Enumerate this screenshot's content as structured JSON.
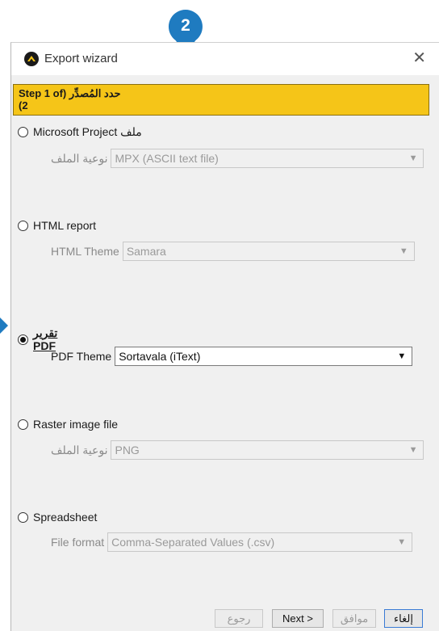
{
  "callout": {
    "number": "2",
    "color": "#1f7bc0"
  },
  "window": {
    "title": "Export wizard",
    "close_glyph": "✕"
  },
  "step": {
    "line1": "Step 1 of) حدد المُصدِّر",
    "line2": "(2"
  },
  "options": [
    {
      "label": "Microsoft Project ملف",
      "checked": false,
      "field_label": "نوعية الملف",
      "field_value": "MPX (ASCII text file)",
      "enabled": false
    },
    {
      "label": "HTML report",
      "checked": false,
      "field_label": "HTML Theme",
      "field_value": "Samara",
      "enabled": false
    },
    {
      "label_line1": "تقرير",
      "label_line2": "PDF",
      "checked": true,
      "field_label": "PDF Theme",
      "field_value": "Sortavala (iText)",
      "enabled": true
    },
    {
      "label": "Raster image file",
      "checked": false,
      "field_label": "نوعية الملف",
      "field_value": "PNG",
      "enabled": false
    },
    {
      "label": "Spreadsheet",
      "checked": false,
      "field_label": "File format",
      "field_value": "Comma-Separated Values (.csv)",
      "enabled": false
    }
  ],
  "dropdown_glyph": "▼",
  "buttons": {
    "back": "رجوع",
    "next": "Next >",
    "ok": "موافق",
    "cancel": "إلغاء"
  },
  "colors": {
    "header_yellow": "#f5c518",
    "accent_blue": "#1f7bc0"
  }
}
